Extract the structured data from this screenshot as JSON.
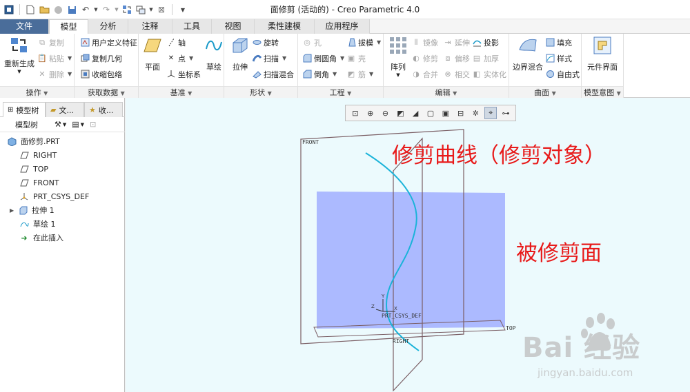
{
  "window": {
    "title": "面修剪 (活动的) - Creo Parametric 4.0"
  },
  "colors": {
    "file_tab": "#4a6d9a",
    "viewport_bg": "#ecfafd",
    "surface": "#a9b6ff",
    "curve": "#1ab3d9",
    "plane_edge": "#7a5e64",
    "annotation": "#e81a1a"
  },
  "tabs": [
    "文件",
    "模型",
    "分析",
    "注释",
    "工具",
    "视图",
    "柔性建模",
    "应用程序"
  ],
  "ribbon": {
    "operations": {
      "label": "操作",
      "regenerate": "重新生成",
      "copy": "复制",
      "paste": "粘贴",
      "delete": "删除"
    },
    "getdata": {
      "label": "获取数据",
      "udf": "用户定义特征",
      "copy_geom": "复制几何",
      "shrinkwrap": "收缩包络"
    },
    "datum": {
      "label": "基准",
      "plane": "平面",
      "axis": "轴",
      "point": "点",
      "csys": "坐标系",
      "sketch": "草绘"
    },
    "shapes": {
      "label": "形状",
      "extrude": "拉伸",
      "revolve": "旋转",
      "sweep": "扫描",
      "swept_blend": "扫描混合"
    },
    "engineering": {
      "label": "工程",
      "hole": "孔",
      "round": "倒圆角",
      "chamfer": "倒角",
      "draft": "拔模",
      "shell": "壳",
      "rib": "筋"
    },
    "editing": {
      "label": "编辑",
      "pattern": "阵列",
      "mirror": "镜像",
      "trim": "修剪",
      "merge": "合并",
      "extend": "延伸",
      "offset": "偏移",
      "intersect": "相交",
      "project": "投影",
      "thicken": "加厚",
      "solidify": "实体化"
    },
    "surfaces": {
      "label": "曲面",
      "boundary_blend": "边界混合",
      "fill": "填充",
      "style": "样式",
      "freestyle": "自由式"
    },
    "intent": {
      "label": "模型意图",
      "component_interface": "元件界面"
    }
  },
  "panel": {
    "tabs": [
      "模型树",
      "文...",
      "收..."
    ],
    "toolbar_label": "模型树",
    "tree": [
      "面修剪.PRT",
      "RIGHT",
      "TOP",
      "FRONT",
      "PRT_CSYS_DEF",
      "拉伸 1",
      "草绘 1",
      "在此插入"
    ]
  },
  "scene_labels": {
    "front": "FRONT",
    "top": "TOP",
    "right": "RIGHT",
    "csys": "PRT_CSYS_DEF",
    "x": "X",
    "y": "Y",
    "z": "Z"
  },
  "annotations": {
    "trim_curve": "修剪曲线（修剪对象）",
    "trimmed_surface": "被修剪面"
  },
  "watermark": {
    "logo": "Bai 经验",
    "url": "jingyan.baidu.com"
  }
}
